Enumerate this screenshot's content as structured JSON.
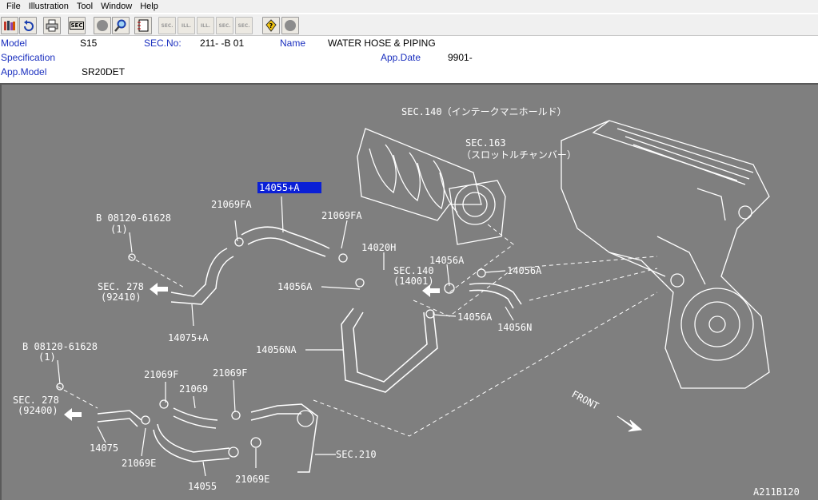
{
  "menu": [
    "File",
    "Illustration",
    "Tool",
    "Window",
    "Help"
  ],
  "toolbar": {
    "sec_label": "SEC",
    "ill_label": "ILL.",
    "sec_small": "SEC."
  },
  "info": {
    "model_label": "Model",
    "model_value": "S15",
    "sec_no_label": "SEC.No:",
    "sec_no_value": "211-  -B 01",
    "name_label": "Name",
    "name_value": "WATER HOSE & PIPING",
    "spec_label": "Specification",
    "app_date_label": "App.Date",
    "app_date_value": "9901-",
    "app_model_label": "App.Model",
    "app_model_value": "SR20DET"
  },
  "diagram": {
    "sec140": "SEC.140（インテークマニホールド）",
    "sec163": "SEC.163",
    "sec163_sub": "（スロットルチャンバー）",
    "p14055A": "14055+A",
    "p21069FA_1": "21069FA",
    "p21069FA_2": "21069FA",
    "bolt1": "B 08120-61628",
    "bolt1_qty": "(1)",
    "p14020H": "14020H",
    "p14056A_1": "14056A",
    "p14056A_2": "14056A",
    "p14056A_3": "14056A",
    "p14056A_4": "14056A",
    "sec140_b": "SEC.140",
    "sec140_b_sub": "(14001)",
    "sec278_1": "SEC. 278",
    "sec278_1_sub": "(92410)",
    "p14075A": "14075+A",
    "p14056NA": "14056NA",
    "p14056N": "14056N",
    "bolt2": "B 08120-61628",
    "bolt2_qty": "(1)",
    "p21069F_1": "21069F",
    "p21069F_2": "21069F",
    "p21069": "21069",
    "sec278_2": "SEC. 278",
    "sec278_2_sub": "(92400)",
    "p14075": "14075",
    "p21069E_1": "21069E",
    "p14055": "14055",
    "p21069E_2": "21069E",
    "sec210": "SEC.210",
    "front": "FRONT",
    "code": "A211B120"
  }
}
